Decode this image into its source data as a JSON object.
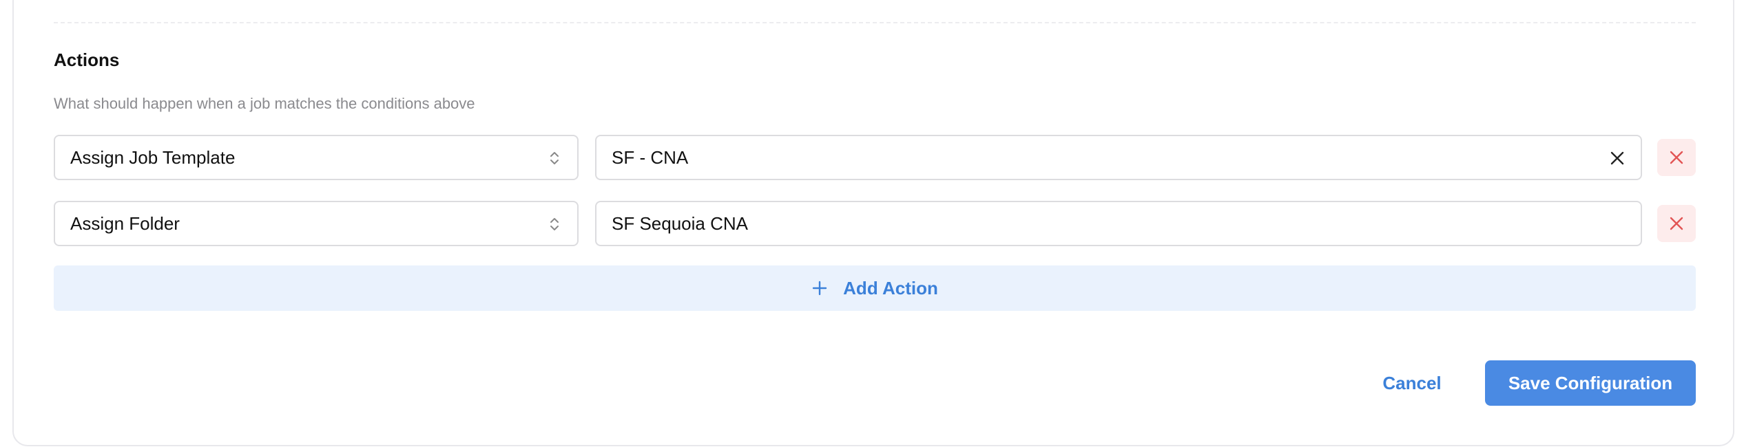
{
  "actions_section": {
    "title": "Actions",
    "description": "What should happen when a job matches the conditions above"
  },
  "action_rows": [
    {
      "type": "Assign Job Template",
      "value": "SF - CNA",
      "clearable": true
    },
    {
      "type": "Assign Folder",
      "value": "SF Sequoia CNA",
      "clearable": false
    }
  ],
  "add_action_label": "Add Action",
  "footer": {
    "cancel_label": "Cancel",
    "save_label": "Save Configuration"
  },
  "colors": {
    "accent": "#4a8ae3",
    "link": "#3b80d9",
    "danger": "#e25555",
    "danger_bg": "#fdecec",
    "add_bg": "#eaf2fd"
  },
  "icons": {
    "select": "chevron-up-down-icon",
    "clear": "close-icon",
    "delete": "close-icon",
    "add": "plus-icon"
  }
}
